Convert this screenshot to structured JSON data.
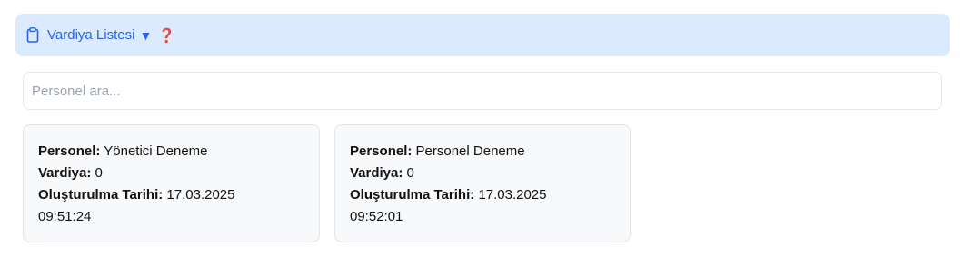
{
  "header": {
    "icon": "clipboard-icon",
    "title": "Vardiya Listesi",
    "caret": "▼",
    "help": "❓"
  },
  "search": {
    "placeholder": "Personel ara...",
    "value": ""
  },
  "labels": {
    "personel": "Personel:",
    "vardiya": "Vardiya:",
    "olusturulma": "Oluşturulma Tarihi:"
  },
  "cards": [
    {
      "personel": "Yönetici Deneme",
      "vardiya": "0",
      "tarih": "17.03.2025",
      "saat": "09:51:24"
    },
    {
      "personel": "Personel Deneme",
      "vardiya": "0",
      "tarih": "17.03.2025",
      "saat": "09:52:01"
    }
  ],
  "colors": {
    "header_bg": "#dbeafe",
    "accent": "#2563eb",
    "help": "#dc2626",
    "card_bg": "#f8f9fb"
  }
}
